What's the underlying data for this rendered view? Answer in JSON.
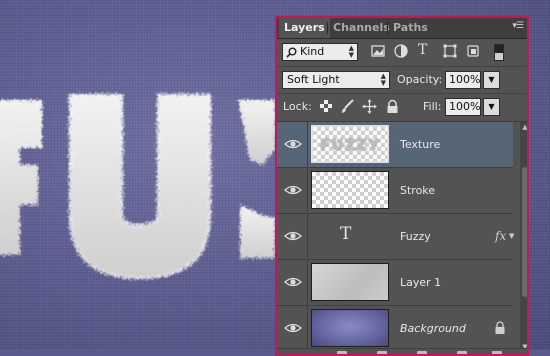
{
  "canvas": {
    "art_text": "FUZ"
  },
  "panel": {
    "tabs": [
      "Layers",
      "Channels",
      "Paths"
    ],
    "active_tab": "Layers",
    "filter": {
      "value": "Kind"
    },
    "blend_mode": {
      "value": "Soft Light"
    },
    "opacity": {
      "label": "Opacity:",
      "value": "100%"
    },
    "lock": {
      "label": "Lock:"
    },
    "fill": {
      "label": "Fill:",
      "value": "100%"
    },
    "layers": [
      {
        "name": "Texture",
        "thumb_text": "FUZZY",
        "selected": true
      },
      {
        "name": "Stroke"
      },
      {
        "name": "Fuzzy",
        "type_glyph": "T",
        "fx": "fx"
      },
      {
        "name": "Layer 1"
      },
      {
        "name": "Background"
      }
    ]
  },
  "colors": {
    "panel_bg": "#535353",
    "selection": "#576677",
    "highlight_border": "#c2185b"
  },
  "icons": [
    "filter-search-icon",
    "image-filter-icon",
    "adjustment-filter-icon",
    "type-filter-icon",
    "shape-filter-icon",
    "smart-object-filter-icon",
    "filter-toggle-icon",
    "lock-transparent-icon",
    "lock-brush-icon",
    "lock-position-icon",
    "lock-all-icon",
    "eye-icon",
    "lock-icon",
    "panel-menu-icon"
  ]
}
